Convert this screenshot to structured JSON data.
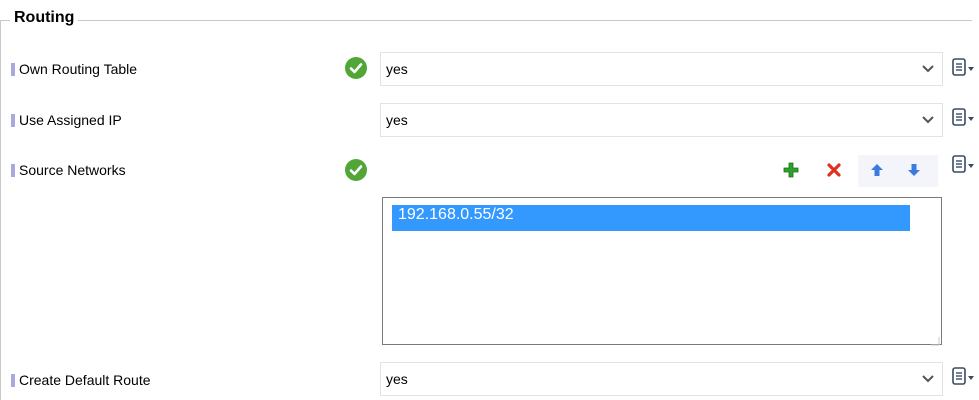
{
  "group": {
    "title": "Routing"
  },
  "rows": {
    "own_routing_table": {
      "label": "Own Routing Table",
      "value": "yes"
    },
    "use_assigned_ip": {
      "label": "Use Assigned IP",
      "value": "yes"
    },
    "source_networks": {
      "label": "Source Networks",
      "items": [
        "192.168.0.55/32"
      ]
    },
    "create_default_route": {
      "label": "Create Default Route",
      "value": "yes"
    }
  },
  "icons": {
    "valid": "check-circle-icon",
    "dropdown": "chevron-down-icon",
    "menu": "clipboard-menu-icon",
    "add": "plus-icon",
    "delete": "x-icon",
    "up": "arrow-up-icon",
    "down": "arrow-down-icon"
  },
  "colors": {
    "marker": "#a9a9e0",
    "valid_green": "#52a637",
    "selection": "#3399ff",
    "add_green": "#2da12d",
    "delete_red": "#e0311f",
    "arrow_blue": "#3c7ae0"
  }
}
